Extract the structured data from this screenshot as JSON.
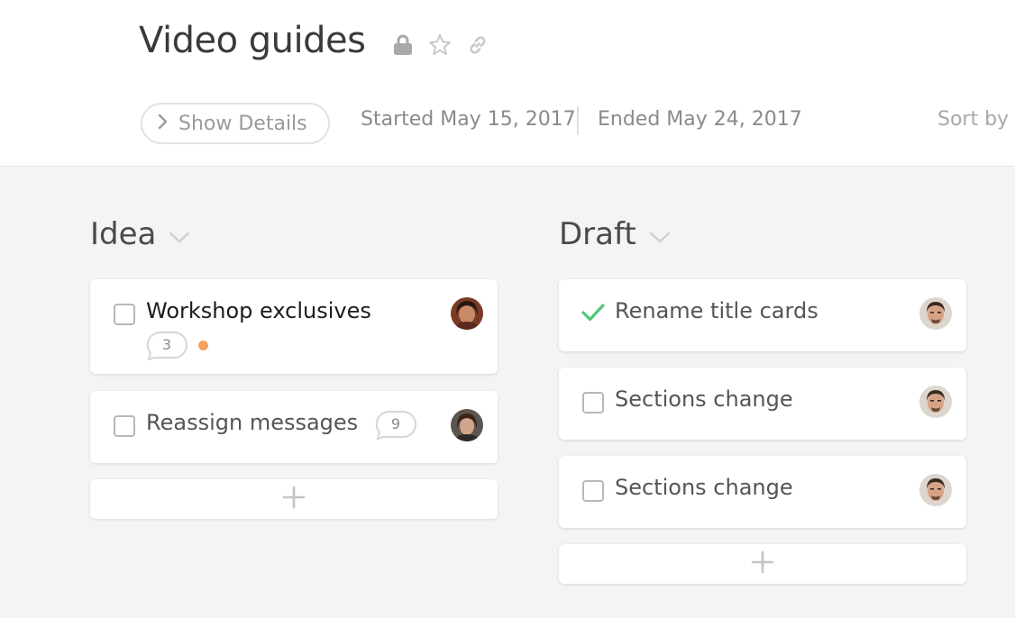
{
  "header": {
    "title": "Video guides",
    "show_details_label": "Show Details",
    "started": "Started May 15, 2017",
    "ended": "Ended May 24, 2017",
    "sort_label": "Sort by I"
  },
  "icons": {
    "lock": "lock-icon",
    "star": "star-icon",
    "link": "link-icon",
    "chevron_right": "chevron-right-icon",
    "chevron_down": "chevron-down-icon",
    "plus": "plus-icon",
    "checkmark": "checkmark-icon"
  },
  "colors": {
    "accent_green": "#4cc97a",
    "unread_dot": "#f6a064",
    "icon_gray": "#c4c4c4"
  },
  "columns": [
    {
      "title": "Idea",
      "cards": [
        {
          "label": "Workshop exclusives",
          "comment_count": "3",
          "has_unread_dot": true,
          "checked": false
        },
        {
          "label": "Reassign messages",
          "comment_count": "9",
          "checked": false
        }
      ]
    },
    {
      "title": "Draft",
      "cards": [
        {
          "label": "Rename title cards",
          "checked": true
        },
        {
          "label": "Sections change",
          "checked": false
        },
        {
          "label": "Sections change",
          "checked": false
        }
      ]
    }
  ]
}
